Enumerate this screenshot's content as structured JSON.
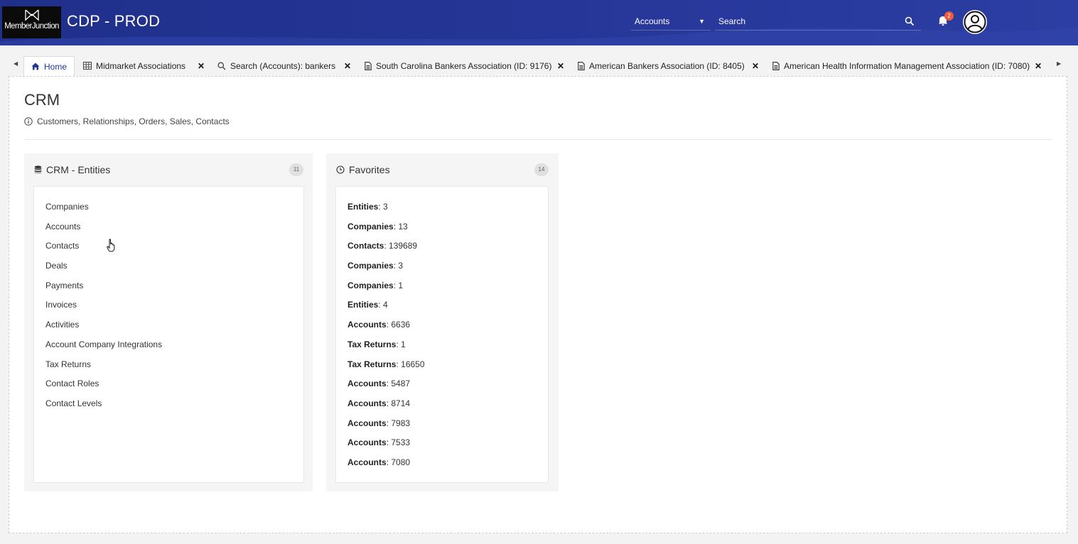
{
  "header": {
    "logo_text": "MemberJunction",
    "app_title": "CDP - PROD",
    "search_scope": "Accounts",
    "search_placeholder": "Search",
    "notification_count": "2",
    "colors": {
      "header_bg": "#27379a",
      "badge": "#ef5b3d",
      "active_tab_text": "#1f3a9a"
    }
  },
  "tabs": [
    {
      "label": "Home",
      "icon": "home-icon",
      "active": true,
      "closable": false
    },
    {
      "label": "Midmarket Associations",
      "icon": "grid-icon",
      "closable": true
    },
    {
      "label": "Search (Accounts): bankers",
      "icon": "search-icon",
      "closable": true
    },
    {
      "label": "South Carolina Bankers Association (ID: 9176)",
      "icon": "document-icon",
      "closable": true
    },
    {
      "label": "American Bankers Association (ID: 8405)",
      "icon": "document-icon",
      "closable": true
    },
    {
      "label": "American Health Information Management Association (ID: 7080)",
      "icon": "document-icon",
      "closable": true
    }
  ],
  "page": {
    "title": "CRM",
    "subtitle": "Customers, Relationships, Orders, Sales, Contacts"
  },
  "entities_card": {
    "title": "CRM - Entities",
    "count": "11",
    "items": [
      "Companies",
      "Accounts",
      "Contacts",
      "Deals",
      "Payments",
      "Invoices",
      "Activities",
      "Account Company Integrations",
      "Tax Returns",
      "Contact Roles",
      "Contact Levels"
    ]
  },
  "favorites_card": {
    "title": "Favorites",
    "count": "14",
    "items": [
      {
        "label": "Entities",
        "value": "3"
      },
      {
        "label": "Companies",
        "value": "13"
      },
      {
        "label": "Contacts",
        "value": "139689"
      },
      {
        "label": "Companies",
        "value": "3"
      },
      {
        "label": "Companies",
        "value": "1"
      },
      {
        "label": "Entities",
        "value": "4"
      },
      {
        "label": "Accounts",
        "value": "6636"
      },
      {
        "label": "Tax Returns",
        "value": "1"
      },
      {
        "label": "Tax Returns",
        "value": "16650"
      },
      {
        "label": "Accounts",
        "value": "5487"
      },
      {
        "label": "Accounts",
        "value": "8714"
      },
      {
        "label": "Accounts",
        "value": "7983"
      },
      {
        "label": "Accounts",
        "value": "7533"
      },
      {
        "label": "Accounts",
        "value": "7080"
      }
    ]
  }
}
